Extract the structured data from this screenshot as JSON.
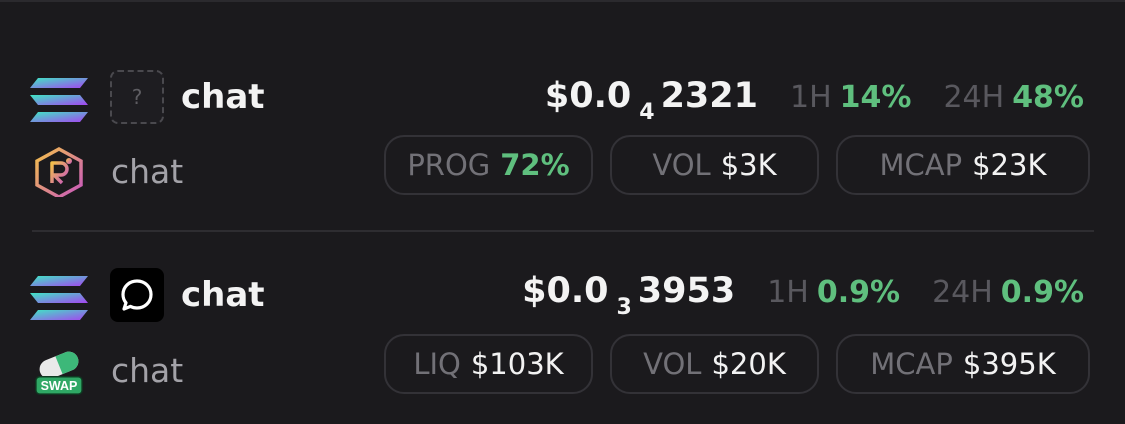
{
  "rows": [
    {
      "chain_icon": "solana-icon",
      "token_icon": "question-placeholder-icon",
      "token_icon_glyph": "?",
      "name": "chat",
      "symbol": "chat",
      "dex_icon": "raydium-icon",
      "price_prefix": "$0.0",
      "price_zero_count": "4",
      "price_digits": "2321",
      "change_1h_label": "1H",
      "change_1h": "14%",
      "change_24h_label": "24H",
      "change_24h": "48%",
      "stats": [
        {
          "label": "PROG",
          "value": "72%",
          "color": "#5fbf7e"
        },
        {
          "label": "VOL",
          "value": "$3K"
        },
        {
          "label": "MCAP",
          "value": "$23K"
        }
      ]
    },
    {
      "chain_icon": "solana-icon",
      "token_icon": "chat-bubble-icon",
      "name": "chat",
      "symbol": "chat",
      "dex_icon": "swap-pill-icon",
      "dex_badge_text": "SWAP",
      "price_prefix": "$0.0",
      "price_zero_count": "3",
      "price_digits": "3953",
      "change_1h_label": "1H",
      "change_1h": "0.9%",
      "change_24h_label": "24H",
      "change_24h": "0.9%",
      "stats": [
        {
          "label": "LIQ",
          "value": "$103K"
        },
        {
          "label": "VOL",
          "value": "$20K"
        },
        {
          "label": "MCAP",
          "value": "$395K"
        }
      ]
    }
  ],
  "colors": {
    "background": "#1b1a1d",
    "positive": "#5fbf7e",
    "muted": "#727177",
    "chip_border": "#333237"
  }
}
